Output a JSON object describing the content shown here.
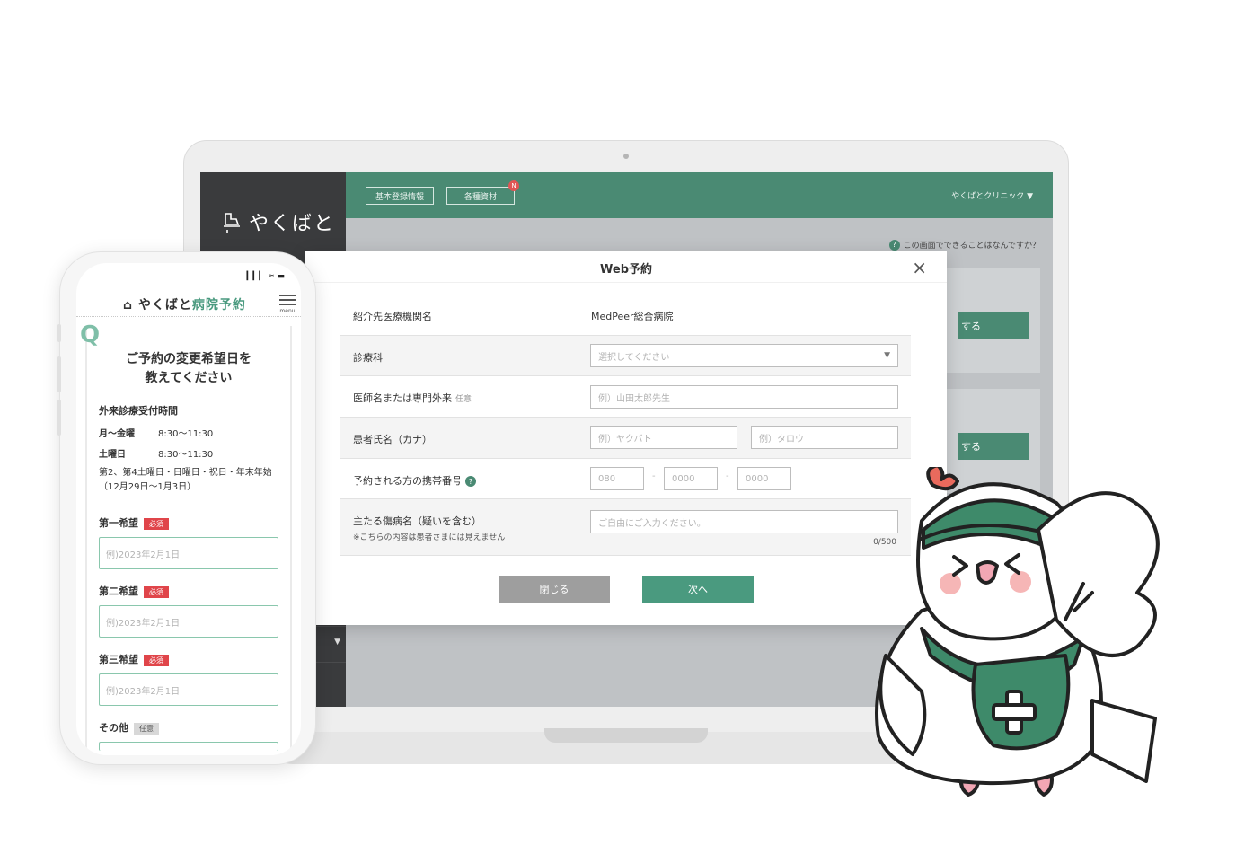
{
  "colors": {
    "brand_green": "#4a8a73",
    "button_green": "#4a9a7f",
    "required_red": "#e0454a"
  },
  "admin": {
    "logo_text": "やくばと",
    "topbar_tabs": [
      "基本登録情報",
      "各種資材"
    ],
    "new_badge": "N",
    "clinic_name": "やくばとクリニック ▼",
    "help_text": "この画面でできることはなんですか？",
    "bg_button_1": "する",
    "bg_button_2": "する"
  },
  "modal": {
    "title": "Web予約",
    "close_icon": "×",
    "rows": {
      "referral_label": "紹介先医療機関名",
      "referral_value": "MedPeer総合病院",
      "dept_label": "診療科",
      "dept_placeholder": "選択してください",
      "doctor_label": "医師名または専門外来",
      "doctor_optional": "任意",
      "doctor_placeholder": "例）山田太郎先生",
      "patient_label": "患者氏名（カナ）",
      "patient_last_placeholder": "例）ヤクバト",
      "patient_first_placeholder": "例）タロウ",
      "phone_label": "予約される方の携帯番号",
      "phone_help": "?",
      "phone_1": "080",
      "phone_2": "0000",
      "phone_3": "0000",
      "phone_dash": "-",
      "disease_label": "主たる傷病名（疑いを含む）",
      "disease_note": "※こちらの内容は患者さまには見えません",
      "disease_placeholder": "ご自由にご入力ください。",
      "disease_counter": "0/500"
    },
    "close_button": "閉じる",
    "next_button": "次へ"
  },
  "phone": {
    "status": "▎▎▎ ≈ ▬",
    "logo_main": "やくばと",
    "logo_accent": "病院予約",
    "menu_label": "menu",
    "q_mark": "Q",
    "title_line1": "ご予約の変更希望日を",
    "title_line2": "教えてください",
    "hours_heading": "外来診療受付時間",
    "weekday_label": "月〜金曜",
    "weekday_hours": "8:30〜11:30",
    "saturday_label": "土曜日",
    "saturday_hours": "8:30〜11:30",
    "closed_note": "第2、第4土曜日・日曜日・祝日・年末年始（12月29日〜1月3日）",
    "first_choice": "第一希望",
    "second_choice": "第二希望",
    "third_choice": "第三希望",
    "other": "その他",
    "required": "必須",
    "optional": "任意",
    "date_placeholder": "例)2023年2月1日"
  }
}
